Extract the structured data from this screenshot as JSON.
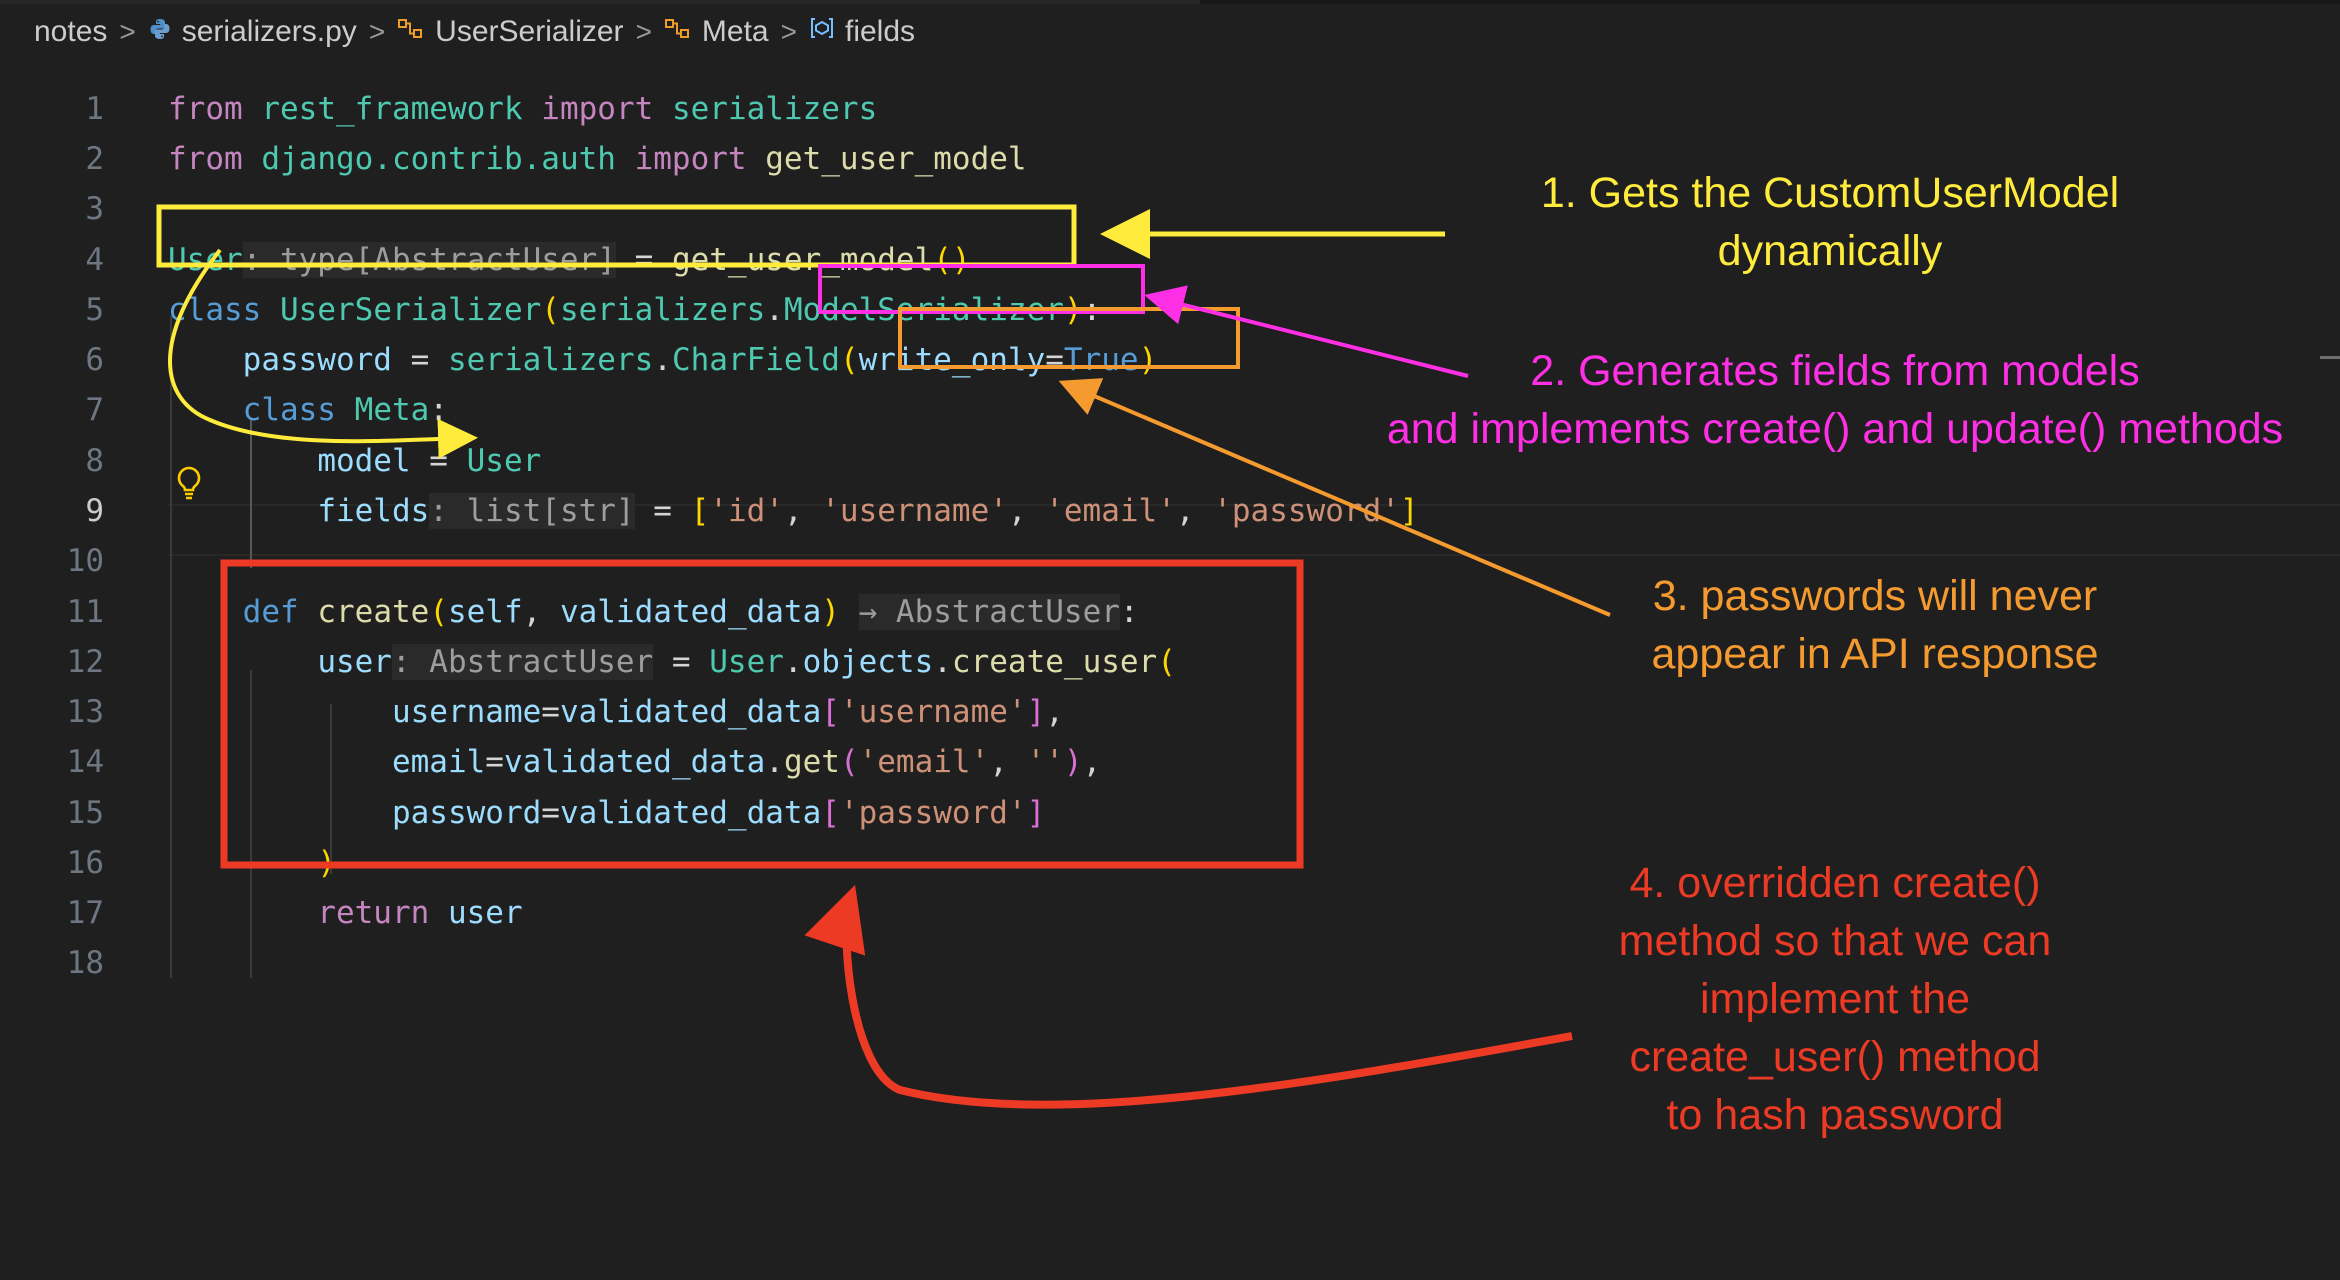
{
  "breadcrumb": {
    "items": [
      {
        "label": "notes",
        "icon": "none"
      },
      {
        "label": "serializers.py",
        "icon": "python-icon"
      },
      {
        "label": "UserSerializer",
        "icon": "class-symbol-icon"
      },
      {
        "label": "Meta",
        "icon": "class-symbol-icon"
      },
      {
        "label": "fields",
        "icon": "field-symbol-icon"
      }
    ],
    "separator": ">"
  },
  "editor": {
    "language": "python",
    "active_line": 9,
    "line_numbers": [
      "1",
      "2",
      "3",
      "4",
      "5",
      "6",
      "7",
      "8",
      "9",
      "10",
      "11",
      "12",
      "13",
      "14",
      "15",
      "16",
      "17",
      "18"
    ]
  },
  "annotations": [
    {
      "id": "ann-1",
      "color": "#ffeb3b",
      "lines": [
        "1. Gets the CustomUserModel",
        "dynamically"
      ]
    },
    {
      "id": "ann-2",
      "color": "#ff2fe5",
      "lines": [
        "2. Generates fields from models",
        "and implements create() and update() methods"
      ]
    },
    {
      "id": "ann-3",
      "color": "#f59a2f",
      "lines": [
        "3. passwords will never",
        "appear in API response"
      ]
    },
    {
      "id": "ann-4",
      "color": "#ec3a25",
      "lines": [
        "4. overridden create()",
        "method so that we can",
        "implement the",
        "create_user() method",
        "to hash password"
      ]
    }
  ],
  "colors": {
    "background": "#1f1f1f",
    "yellow": "#ffeb3b",
    "magenta": "#ff2fe5",
    "orange": "#f59a2f",
    "red": "#ec3a25"
  }
}
